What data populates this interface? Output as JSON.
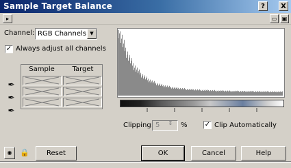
{
  "window": {
    "title": "Sample Target Balance"
  },
  "titlebar_buttons": {
    "help": "?",
    "close": "X"
  },
  "channel": {
    "label": "Channel:",
    "value": "RGB Channels"
  },
  "always_adjust": {
    "label": "Always adjust all channels",
    "checked": true
  },
  "table": {
    "headers": [
      "Sample",
      "Target"
    ]
  },
  "clipping": {
    "label": "Clipping:",
    "value": "5",
    "unit": "%"
  },
  "clip_auto": {
    "label": "Clip Automatically",
    "checked": true
  },
  "buttons": {
    "reset": "Reset",
    "ok": "OK",
    "cancel": "Cancel",
    "help": "Help"
  }
}
